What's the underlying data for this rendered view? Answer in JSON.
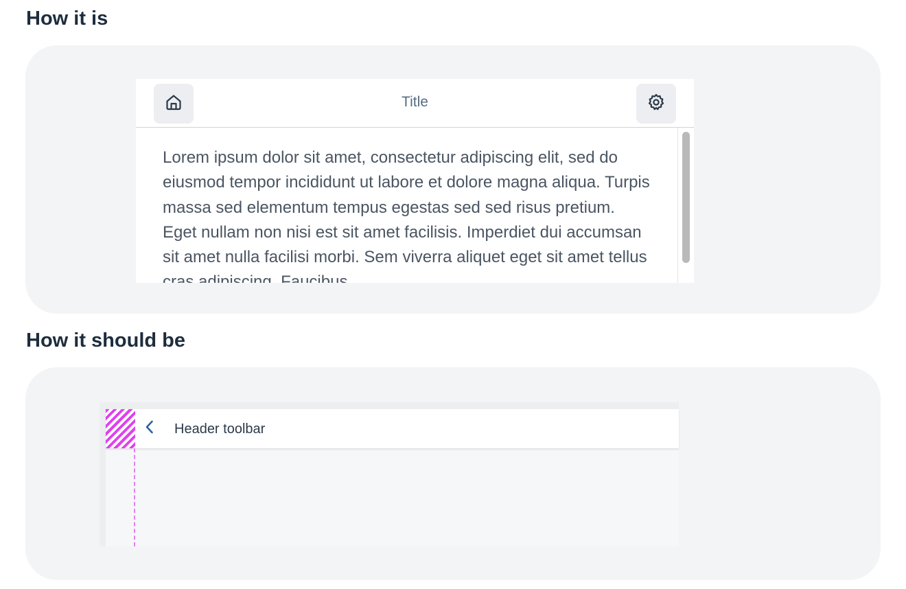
{
  "sections": [
    {
      "heading": "How it is"
    },
    {
      "heading": "How it should be"
    }
  ],
  "dialog": {
    "title": "Title",
    "body_text": "Lorem ipsum dolor sit amet, consectetur adipiscing elit, sed do eiusmod tempor incididunt ut labore et dolore magna aliqua. Turpis massa sed elementum tempus egestas sed sed risus pretium. Eget nullam non nisi est sit amet facilisis. Imperdiet dui accumsan sit amet nulla facilisi morbi. Sem viverra aliquet eget sit amet tellus cras adipiscing. Faucibus",
    "left_icon": "home-icon",
    "right_icon": "gear-icon"
  },
  "toolbar": {
    "label": "Header toolbar",
    "back_icon": "chevron-left-icon"
  },
  "colors": {
    "panel_bg": "#f3f4f6",
    "heading": "#1d2d3e",
    "highlight": "#e040f0",
    "accent_icon": "#2f5f9e"
  }
}
